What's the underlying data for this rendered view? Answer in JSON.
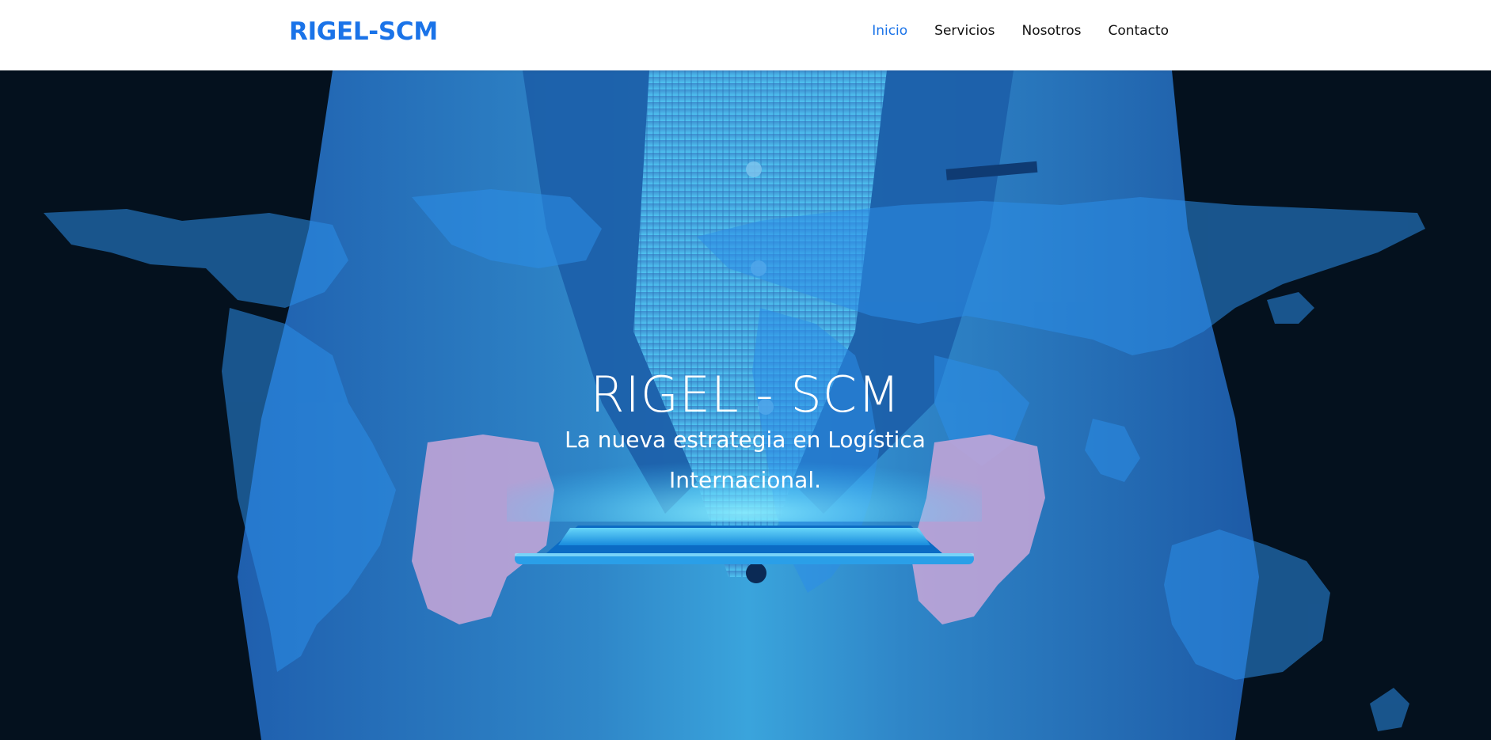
{
  "header": {
    "brand": "RIGEL-SCM",
    "nav": [
      {
        "label": "Inicio",
        "active": true
      },
      {
        "label": "Servicios",
        "active": false
      },
      {
        "label": "Nosotros",
        "active": false
      },
      {
        "label": "Contacto",
        "active": false
      }
    ]
  },
  "hero": {
    "title": "RIGEL - SCM",
    "subtitle": "La nueva estrategia en Logística Internacional."
  },
  "colors": {
    "brand": "#1a73e8",
    "nav_active": "#1a73e8",
    "nav_text": "#111111",
    "hero_background": "#04111e",
    "suit_blue": "#1d6fb8",
    "map_blue": "#2b8ee8",
    "tablet_glow": "#3ec8ff"
  }
}
